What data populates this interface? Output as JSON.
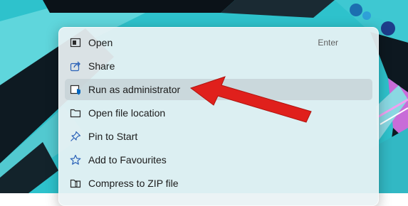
{
  "menu": {
    "items": [
      {
        "label": "Open",
        "shortcut": "Enter",
        "icon": "open-window-icon"
      },
      {
        "label": "Share",
        "icon": "share-icon"
      },
      {
        "label": "Run as administrator",
        "icon": "shield-admin-icon",
        "highlighted": true
      },
      {
        "label": "Open file location",
        "icon": "folder-icon"
      },
      {
        "label": "Pin to Start",
        "icon": "pin-icon"
      },
      {
        "label": "Add to Favourites",
        "icon": "star-icon"
      },
      {
        "label": "Compress to ZIP file",
        "icon": "zip-folder-icon"
      }
    ]
  },
  "colors": {
    "accent": "#0067c0",
    "annotation_arrow": "#e0201c",
    "menu_background": "#e9f2f4",
    "hover_background": "#c4d0d4"
  }
}
